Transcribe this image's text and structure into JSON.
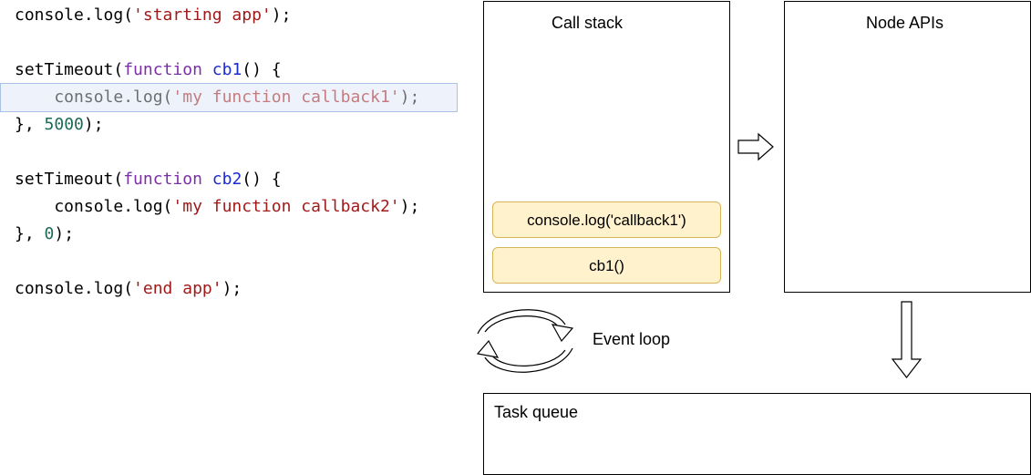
{
  "code": {
    "lines": [
      [
        {
          "t": "console.log(",
          "c": "p"
        },
        {
          "t": "'starting app'",
          "c": "s"
        },
        {
          "t": ");",
          "c": "p"
        }
      ],
      [],
      [
        {
          "t": "setTimeout(",
          "c": "p"
        },
        {
          "t": "function",
          "c": "k"
        },
        {
          "t": " ",
          "c": "p"
        },
        {
          "t": "cb1",
          "c": "fn"
        },
        {
          "t": "() {",
          "c": "p"
        }
      ],
      [
        {
          "t": "    console.log(",
          "c": "p"
        },
        {
          "t": "'my function callback1'",
          "c": "s"
        },
        {
          "t": ");",
          "c": "p"
        }
      ],
      [
        {
          "t": "}, ",
          "c": "p"
        },
        {
          "t": "5000",
          "c": "n"
        },
        {
          "t": ");",
          "c": "p"
        }
      ],
      [],
      [
        {
          "t": "setTimeout(",
          "c": "p"
        },
        {
          "t": "function",
          "c": "k"
        },
        {
          "t": " ",
          "c": "p"
        },
        {
          "t": "cb2",
          "c": "fn"
        },
        {
          "t": "() {",
          "c": "p"
        }
      ],
      [
        {
          "t": "    console.log(",
          "c": "p"
        },
        {
          "t": "'my function callback2'",
          "c": "s"
        },
        {
          "t": ");",
          "c": "p"
        }
      ],
      [
        {
          "t": "}, ",
          "c": "p"
        },
        {
          "t": "0",
          "c": "n"
        },
        {
          "t": ");",
          "c": "p"
        }
      ],
      [],
      [
        {
          "t": "console.log(",
          "c": "p"
        },
        {
          "t": "'end app'",
          "c": "s"
        },
        {
          "t": ");",
          "c": "p"
        }
      ]
    ],
    "highlighted_line": 3
  },
  "diagram": {
    "call_stack": {
      "title": "Call stack",
      "frames": [
        "console.log('callback1')",
        "cb1()"
      ]
    },
    "node_apis": {
      "title": "Node APIs"
    },
    "event_loop": {
      "label": "Event loop"
    },
    "task_queue": {
      "title": "Task queue"
    }
  },
  "colors": {
    "frame_fill": "#fff2cc",
    "frame_border": "#d6b656",
    "highlight_fill": "#eef3fb",
    "highlight_border": "#a9c2e6",
    "keyword": "#7b2fa6",
    "function_name": "#1a2bd1",
    "string": "#a11a1a",
    "number": "#1d6b57"
  }
}
